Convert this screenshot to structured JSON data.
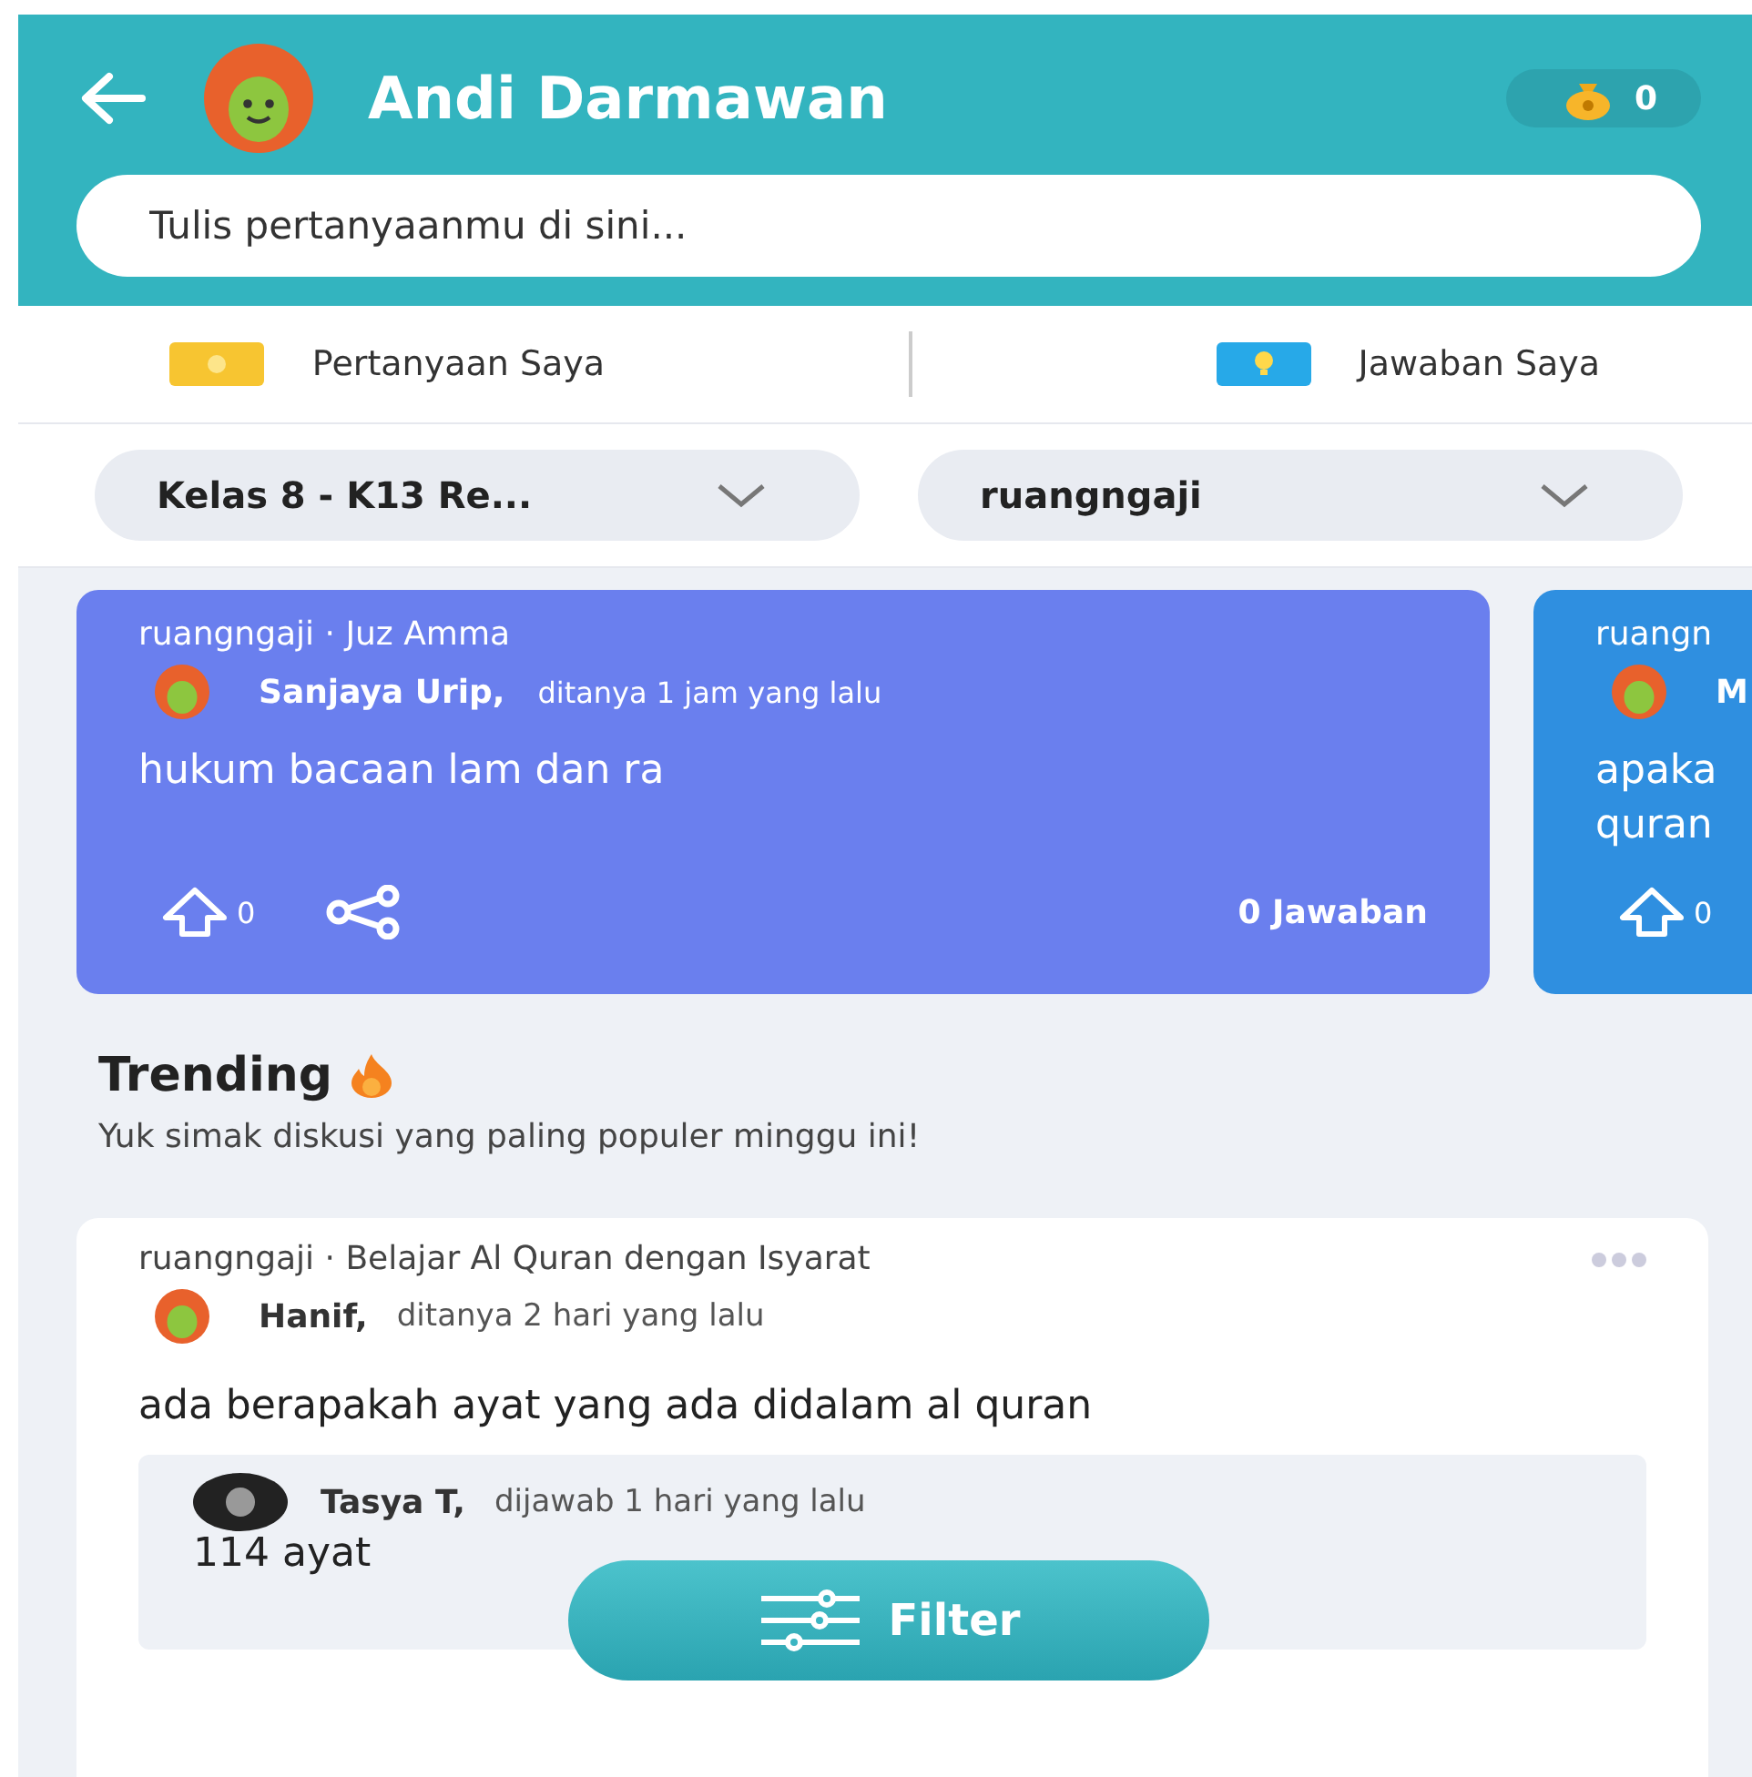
{
  "header": {
    "title": "Andi Darmawan",
    "points": "0",
    "search": {
      "placeholder": "Tulis pertanyaanmu di sini..."
    }
  },
  "tabs": [
    {
      "label": "Pertanyaan Saya",
      "kind": "question"
    },
    {
      "label": "Jawaban Saya",
      "kind": "answer"
    }
  ],
  "filters": [
    {
      "value": "Kelas 8 - K13 Re..."
    },
    {
      "value": "ruangngaji"
    }
  ],
  "featured": [
    {
      "topic": "ruangngaji · Juz Amma",
      "author": "Sanjaya Urip,",
      "time": "ditanya  1 jam yang lalu",
      "question": "hukum bacaan lam dan ra",
      "votes": "0",
      "answers": "0 Jawaban",
      "color": "#6a7fee"
    },
    {
      "topic": "ruangn",
      "author": "M",
      "question": "apaka\nquran",
      "votes": "0",
      "color": "#2f8fe0"
    }
  ],
  "trending": {
    "title": "Trending",
    "subtitle": "Yuk simak diskusi yang paling populer minggu ini!"
  },
  "post": {
    "topic": "ruangngaji · Belajar Al Quran dengan Isyarat",
    "author": "Hanif,",
    "time": "ditanya  2 hari yang lalu",
    "question": "ada berapakah ayat yang ada didalam al quran",
    "answer": {
      "author": "Tasya T,",
      "time": "dijawab  1 hari yang lalu",
      "text": "114 ayat"
    }
  },
  "filter_button": {
    "label": "Filter"
  }
}
